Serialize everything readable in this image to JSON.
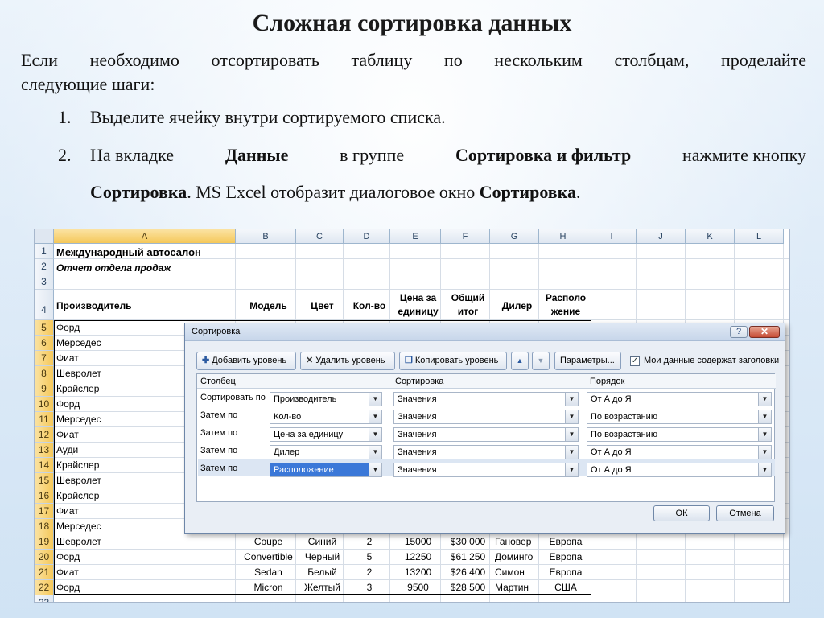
{
  "slide": {
    "title": "Сложная сортировка данных",
    "intro_line1": "Если необходимо отсортировать таблицу по нескольким столбцам, проделайте",
    "intro_line2": "следующие шаги:",
    "step1_num": "1.",
    "step1": "Выделите ячейку внутри сортируемого списка.",
    "step2_num": "2.",
    "step2_a": "На вкладке",
    "step2_b": "Данные",
    "step2_c": "в группе",
    "step2_d": "Сортировка и фильтр",
    "step2_e": "нажмите кнопку",
    "step2_f": "Сортировка",
    "step2_g": ". MS Excel отобразит диалоговое окно",
    "step2_h": "Сортировка",
    "step2_i": "."
  },
  "sheet": {
    "columns": [
      "A",
      "B",
      "C",
      "D",
      "E",
      "F",
      "G",
      "H",
      "I",
      "J",
      "K",
      "L"
    ],
    "row_numbers": [
      "1",
      "2",
      "3",
      "4",
      "5",
      "6",
      "7",
      "8",
      "9",
      "10",
      "11",
      "12",
      "13",
      "14",
      "15",
      "16",
      "17",
      "18",
      "19",
      "20",
      "21",
      "22",
      "23"
    ],
    "title": "Международный автосалон",
    "subtitle": "Отчет отдела продаж",
    "headers": {
      "a": "Производитель",
      "b": "Модель",
      "c": "Цвет",
      "d": "Кол-во",
      "e1": "Цена за",
      "e2": "единицу",
      "f1": "Общий",
      "f2": "итог",
      "g": "Дилер",
      "h1": "Располо",
      "h2": "жение"
    },
    "makers": [
      "Форд",
      "Мерседес",
      "Фиат",
      "Шевролет",
      "Крайслер",
      "Форд",
      "Мерседес",
      "Фиат",
      "Ауди",
      "Крайслер",
      "Шевролет",
      "Крайслер",
      "Фиат",
      "Мерседес",
      "Шевролет",
      "Форд",
      "Фиат",
      "Форд"
    ],
    "rows": [
      {
        "model": "Coupe",
        "color": "Синий",
        "qty": "2",
        "price": "15000",
        "total": "$30 000",
        "dealer": "Гановер",
        "loc": "Европа"
      },
      {
        "model": "Convertible",
        "color": "Черный",
        "qty": "5",
        "price": "12250",
        "total": "$61 250",
        "dealer": "Доминго",
        "loc": "Европа"
      },
      {
        "model": "Sedan",
        "color": "Белый",
        "qty": "2",
        "price": "13200",
        "total": "$26 400",
        "dealer": "Симон",
        "loc": "Европа"
      },
      {
        "model": "Micron",
        "color": "Желтый",
        "qty": "3",
        "price": "9500",
        "total": "$28 500",
        "dealer": "Мартин",
        "loc": "США"
      }
    ]
  },
  "dialog": {
    "title": "Сортировка",
    "help": "?",
    "close": "✕",
    "add_level": "Добавить уровень",
    "delete_level": "Удалить уровень",
    "copy_level": "Копировать уровень",
    "up": "▲",
    "down": "▼",
    "options": "Параметры...",
    "has_headers": "Мои данные содержат заголовки",
    "col_header": "Столбец",
    "sort_header": "Сортировка",
    "order_header": "Порядок",
    "levels": [
      {
        "label": "Сортировать по",
        "column": "Производитель",
        "sort_on": "Значения",
        "order": "От А до Я"
      },
      {
        "label": "Затем по",
        "column": "Кол-во",
        "sort_on": "Значения",
        "order": "По возрастанию"
      },
      {
        "label": "Затем по",
        "column": "Цена за единицу",
        "sort_on": "Значения",
        "order": "По возрастанию"
      },
      {
        "label": "Затем по",
        "column": "Дилер",
        "sort_on": "Значения",
        "order": "От А до Я"
      },
      {
        "label": "Затем по",
        "column": "Расположение",
        "sort_on": "Значения",
        "order": "От А до Я"
      }
    ],
    "ok": "ОК",
    "cancel": "Отмена"
  }
}
